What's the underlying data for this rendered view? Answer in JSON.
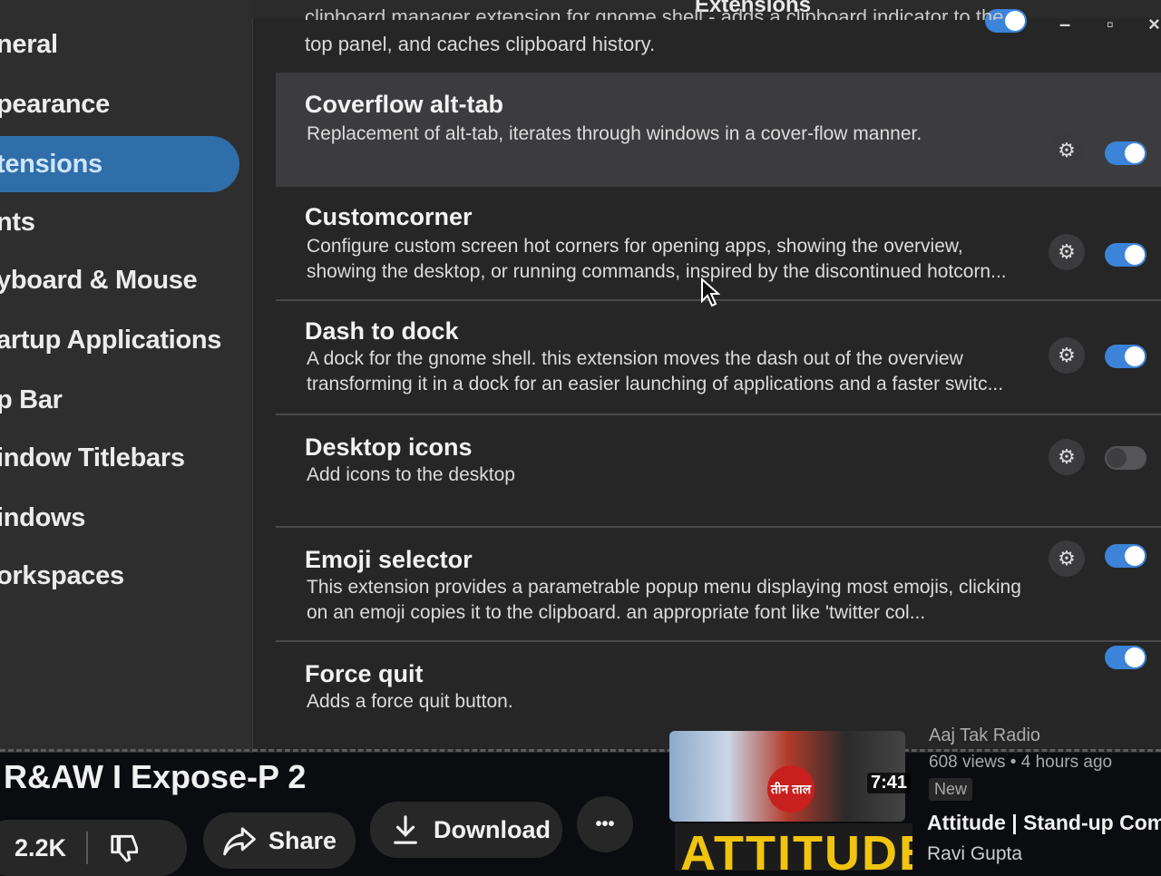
{
  "window": {
    "title": "Extensions",
    "controls": {
      "minimize": "–",
      "maximize": "▫",
      "close": "×"
    }
  },
  "sidebar": {
    "items": [
      {
        "label": "neral",
        "active": false
      },
      {
        "label": "pearance",
        "active": false
      },
      {
        "label": "tensions",
        "active": true
      },
      {
        "label": "nts",
        "active": false
      },
      {
        "label": "yboard & Mouse",
        "active": false
      },
      {
        "label": "artup Applications",
        "active": false
      },
      {
        "label": "p Bar",
        "active": false
      },
      {
        "label": "indow Titlebars",
        "active": false
      },
      {
        "label": "indows",
        "active": false
      },
      {
        "label": "orkspaces",
        "active": false
      }
    ]
  },
  "extensions": {
    "previous_desc_top": "clipboard manager extension for gnome shell - adds a clipboard indicator to the",
    "previous_desc": "top panel, and caches clipboard history.",
    "items": [
      {
        "name": "Coverflow alt-tab",
        "desc": "Replacement of alt-tab, iterates through windows in a cover-flow manner.",
        "enabled": true,
        "has_settings": true
      },
      {
        "name": "Customcorner",
        "desc": "Configure custom screen hot corners for opening apps, showing the overview, showing the desktop, or running commands, inspired by the discontinued hotcorn...",
        "enabled": true,
        "has_settings": true
      },
      {
        "name": "Dash to dock",
        "desc": "A dock for the gnome shell. this extension moves the dash out of the overview transforming it in a dock for an easier launching of applications and a faster switc...",
        "enabled": true,
        "has_settings": true
      },
      {
        "name": "Desktop icons",
        "desc": "Add icons to the desktop",
        "enabled": false,
        "has_settings": true
      },
      {
        "name": "Emoji selector",
        "desc": "This extension provides a parametrable popup menu displaying most emojis, clicking on an emoji copies it to the clipboard. an appropriate font like 'twitter col...",
        "enabled": true,
        "has_settings": true
      },
      {
        "name": "Force quit",
        "desc": "Adds a force quit button.",
        "enabled": true,
        "has_settings": false
      }
    ]
  },
  "video": {
    "title": "R&AW  I Expose-P 2",
    "likes": "2.2K",
    "share_label": "Share",
    "download_label": "Download",
    "more_label": "•••"
  },
  "recommendations": [
    {
      "channel": "Aaj Tak Radio",
      "views": "608 views",
      "age": "4 hours ago",
      "badge": "New",
      "duration": "7:41",
      "thumb_badge": "तीन ताल"
    },
    {
      "title": "Attitude | Stand-up Comedy",
      "channel": "Ravi Gupta",
      "thumb_text": "ATTITUDE"
    }
  ]
}
